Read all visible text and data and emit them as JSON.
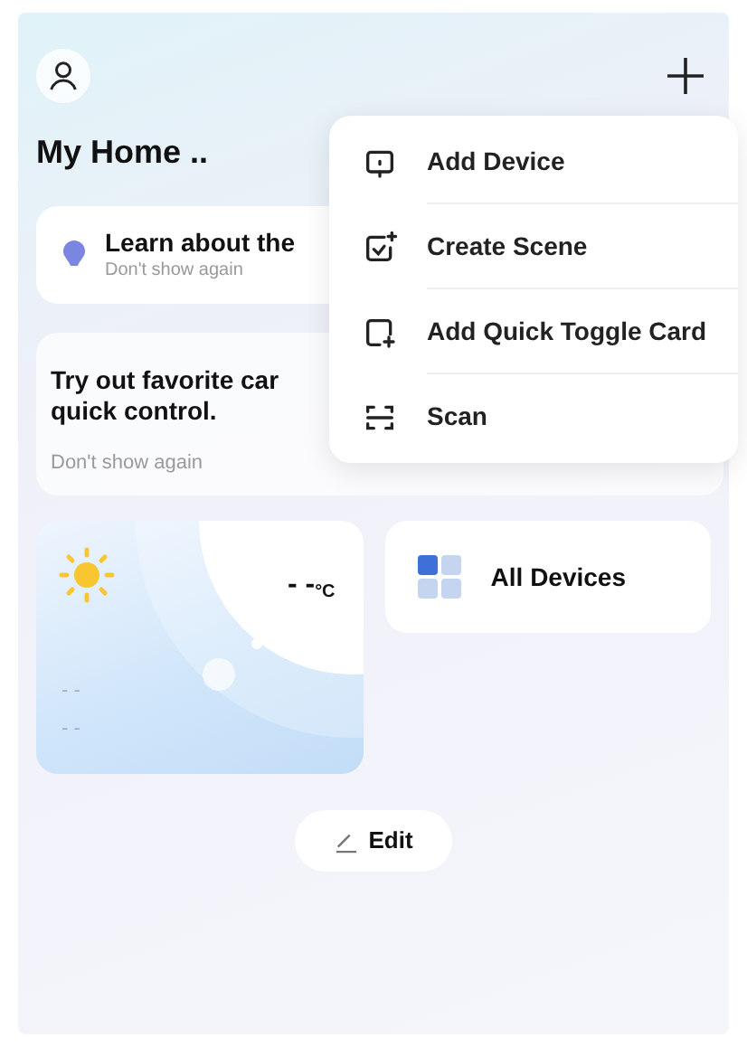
{
  "home_title": "My Home ..",
  "tip_card": {
    "title": "Learn about the",
    "dismiss": "Don't show again"
  },
  "promo_card": {
    "lines": [
      "Try out favorite car",
      "quick control."
    ],
    "dismiss": "Don't show again"
  },
  "weather_card": {
    "temperature": "- -",
    "unit": "°C",
    "details": [
      "- -",
      "- -"
    ]
  },
  "all_devices": {
    "label": "All Devices"
  },
  "edit_button": {
    "label": "Edit"
  },
  "add_menu": {
    "items": [
      {
        "kind": "device",
        "label": "Add Device"
      },
      {
        "kind": "scene",
        "label": "Create Scene"
      },
      {
        "kind": "card",
        "label": "Add Quick Toggle Card"
      },
      {
        "kind": "scan",
        "label": "Scan"
      }
    ]
  }
}
